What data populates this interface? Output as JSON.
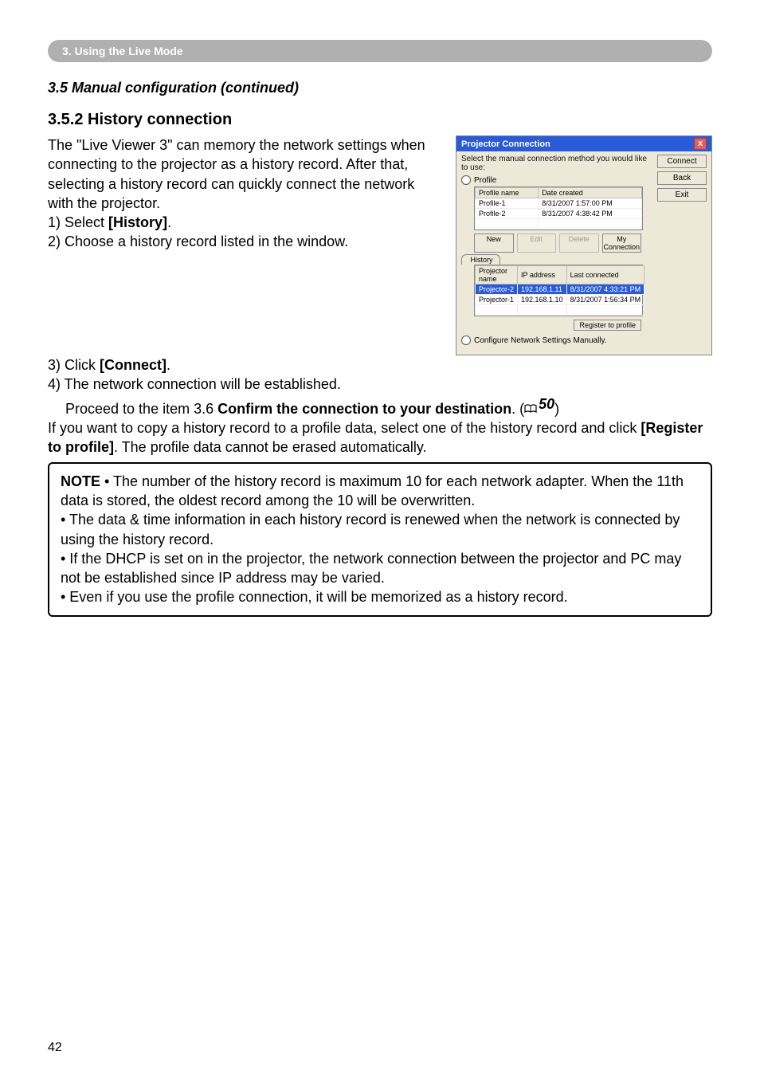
{
  "breadcrumb": "3. Using the Live Mode",
  "section_heading": "3.5 Manual configuration (continued)",
  "subsection_heading": "3.5.2 History connection",
  "intro": "The \"Live Viewer 3\" can memory the network settings when connecting to the projector as a history record. After that, selecting a history record can quickly connect the network with the projector.",
  "step1_prefix": "1) Select ",
  "step1_bold": "[History]",
  "step1_suffix": ".",
  "step2": "2) Choose a history record listed in the window.",
  "step3_prefix": "3) Click ",
  "step3_bold": "[Connect]",
  "step3_suffix": ".",
  "step4_line1": "4) The network connection will be established.",
  "step4_line2_prefix": "Proceed to the item 3.6 ",
  "step4_line2_bold": "Confirm the connection to your destination",
  "step4_line2_suffix1": ". (",
  "step4_ref": "50",
  "step4_line2_suffix2": ")",
  "copy_para_prefix": "If you want to copy a history record to a profile data, select one of the history record and click ",
  "copy_para_bold": "[Register to profile]",
  "copy_para_suffix": ". The profile data cannot be erased automatically.",
  "note_label": "NOTE",
  "note1": " • The number of the history record is maximum 10 for each network adapter. When the 11th data is stored, the oldest record among the 10 will be overwritten.",
  "note2": "• The data & time information in each history record is renewed when the network is connected by using the history record.",
  "note3": "• If the DHCP is set on in the projector, the network connection between the projector and PC may not be established since IP address may be varied.",
  "note4": "• Even if you use the profile connection, it will be memorized as a history record.",
  "page_number": "42",
  "screenshot": {
    "title": "Projector Connection",
    "instruction": "Select the manual connection method you would like to use:",
    "radio_profile": "Profile",
    "radio_history": "History",
    "radio_configure": "Configure Network Settings Manually.",
    "profile_cols": {
      "c1": "Profile name",
      "c2": "Date created"
    },
    "profile_rows": [
      {
        "name": "Profile-1",
        "date": "8/31/2007 1:57:00 PM"
      },
      {
        "name": "Profile-2",
        "date": "8/31/2007 4:38:42 PM"
      }
    ],
    "profile_btns": {
      "new": "New",
      "edit": "Edit",
      "delete": "Delete",
      "my": "My Connection"
    },
    "history_cols": {
      "c1": "Projector name",
      "c2": "IP address",
      "c3": "Last connected"
    },
    "history_rows": [
      {
        "name": "Projector-2",
        "ip": "192.168.1.11",
        "last": "8/31/2007 4:33:21 PM",
        "sel": true
      },
      {
        "name": "Projector-1",
        "ip": "192.168.1.10",
        "last": "8/31/2007 1:56:34 PM",
        "sel": false
      }
    ],
    "reg_btn": "Register to profile",
    "side": {
      "connect": "Connect",
      "back": "Back",
      "exit": "Exit"
    }
  }
}
